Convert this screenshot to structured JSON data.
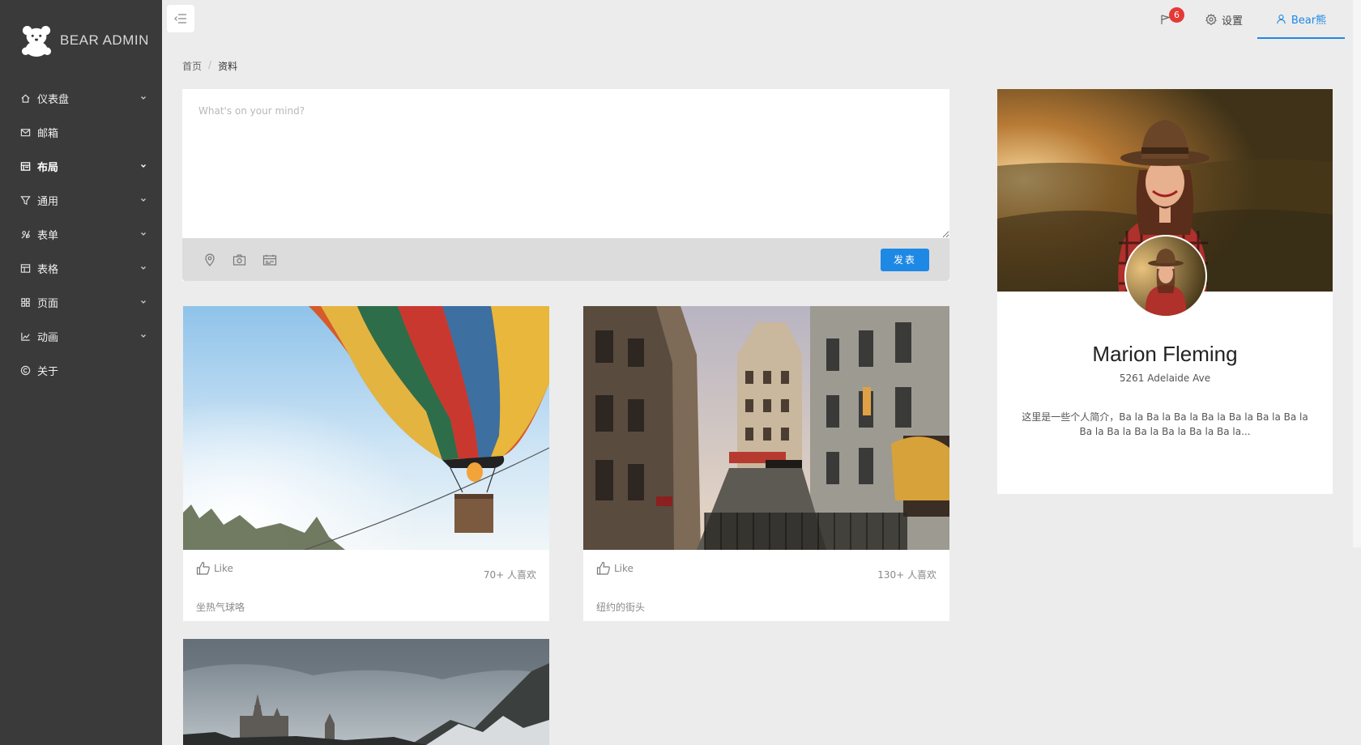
{
  "sidebar": {
    "brand": "BEAR ADMIN",
    "items": [
      {
        "label": "仪表盘",
        "icon": "home-icon",
        "has_children": true,
        "active": false
      },
      {
        "label": "邮箱",
        "icon": "mail-icon",
        "has_children": false,
        "active": false
      },
      {
        "label": "布局",
        "icon": "layout-icon",
        "has_children": true,
        "active": true
      },
      {
        "label": "通用",
        "icon": "filter-icon",
        "has_children": true,
        "active": false
      },
      {
        "label": "表单",
        "icon": "form-icon",
        "has_children": true,
        "active": false
      },
      {
        "label": "表格",
        "icon": "table-icon",
        "has_children": true,
        "active": false
      },
      {
        "label": "页面",
        "icon": "grid-icon",
        "has_children": true,
        "active": false
      },
      {
        "label": "动画",
        "icon": "chart-icon",
        "has_children": true,
        "active": false
      },
      {
        "label": "关于",
        "icon": "copyright-icon",
        "has_children": false,
        "active": false
      }
    ]
  },
  "header": {
    "notifications_count": "6",
    "settings_label": "设置",
    "user_label": "Bear熊"
  },
  "breadcrumb": {
    "home": "首页",
    "separator": "/",
    "current": "资料"
  },
  "composer": {
    "placeholder": "What's on your mind?",
    "post_label": "发表"
  },
  "posts": [
    {
      "like_label": "Like",
      "likes": "70+ 人喜欢",
      "caption": "坐热气球咯"
    },
    {
      "like_label": "Like",
      "likes": "130+ 人喜欢",
      "caption": "纽约的街头"
    }
  ],
  "profile": {
    "name": "Marion Fleming",
    "address": "5261 Adelaide Ave",
    "bio": "这里是一些个人简介，Ba la Ba la Ba la Ba la Ba la Ba la Ba la Ba la Ba la Ba la Ba la Ba la Ba la..."
  },
  "colors": {
    "sidebar_bg": "#3a3a3a",
    "accent": "#1e88e5",
    "badge": "#e53935",
    "page_bg": "#ececec"
  }
}
